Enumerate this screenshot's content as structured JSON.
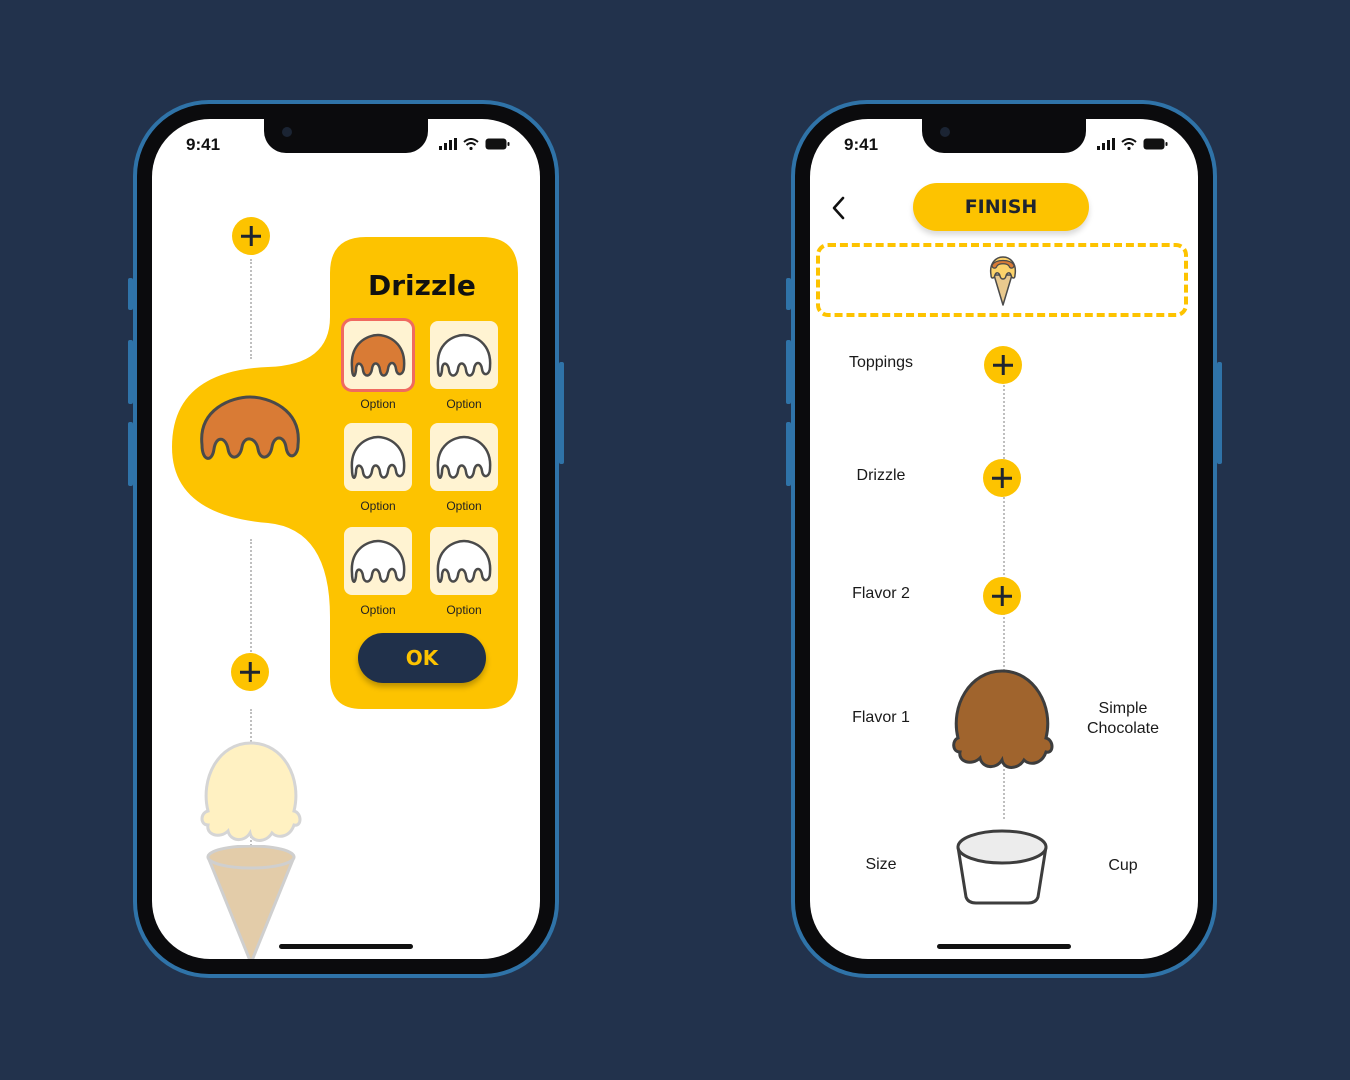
{
  "colors": {
    "background": "#22324c",
    "accent": "#fdc300",
    "dark": "#20304a",
    "drizzle": "#d97b35",
    "selected_outline": "#f06a5f",
    "tile": "#fff3d2",
    "chocolate": "#a0642d",
    "vanilla": "#fff1c2",
    "cone": "#e3cca9"
  },
  "status_bar": {
    "time": "9:41",
    "icons": [
      "signal-icon",
      "wifi-icon",
      "battery-icon"
    ]
  },
  "left_screen": {
    "panel_title": "Drizzle",
    "options": [
      {
        "label": "Option",
        "selected": true
      },
      {
        "label": "Option",
        "selected": false
      },
      {
        "label": "Option",
        "selected": false
      },
      {
        "label": "Option",
        "selected": false
      },
      {
        "label": "Option",
        "selected": false
      },
      {
        "label": "Option",
        "selected": false
      }
    ],
    "ok_label": "OK"
  },
  "right_screen": {
    "finish_label": "FINISH",
    "rows": [
      {
        "label": "Toppings",
        "value": ""
      },
      {
        "label": "Drizzle",
        "value": ""
      },
      {
        "label": "Flavor 2",
        "value": ""
      },
      {
        "label": "Flavor 1",
        "value_line1": "Simple",
        "value_line2": "Chocolate"
      },
      {
        "label": "Size",
        "value": "Cup"
      }
    ]
  }
}
